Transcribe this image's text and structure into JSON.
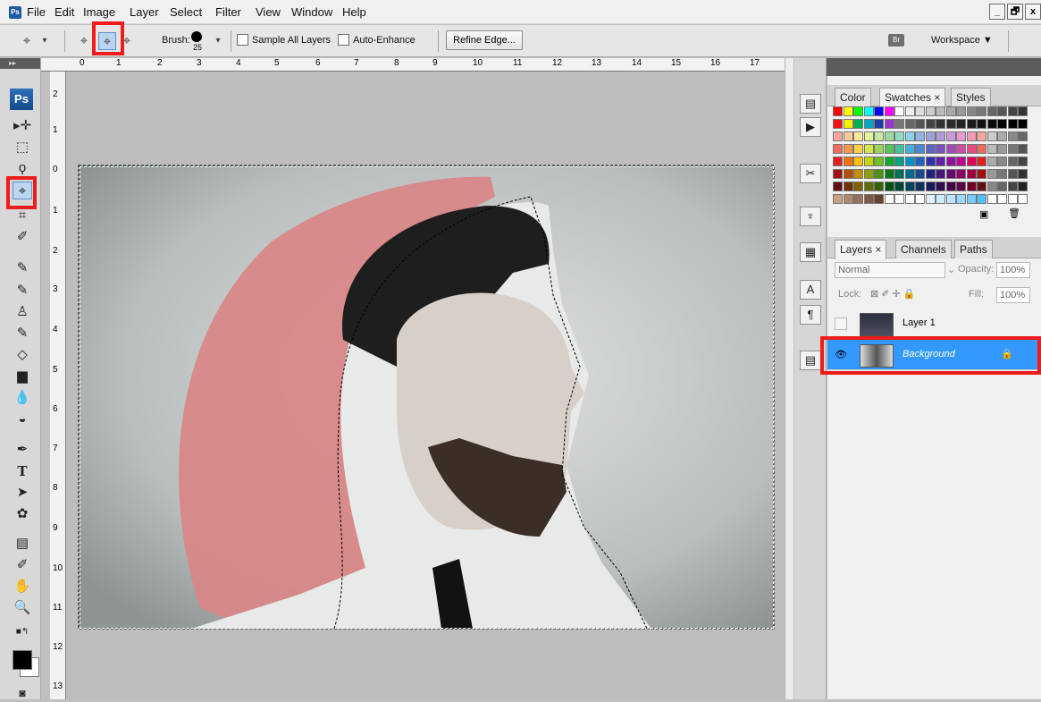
{
  "menu": {
    "app_icon": "Ps",
    "items": [
      "File",
      "Edit",
      "Image",
      "Layer",
      "Select",
      "Filter",
      "View",
      "Window",
      "Help"
    ]
  },
  "window_controls": [
    "_",
    "🗗",
    "x"
  ],
  "options_bar": {
    "brush_label": "Brush:",
    "brush_size": "25",
    "sample_all_layers": "Sample All Layers",
    "auto_enhance": "Auto-Enhance",
    "refine_edge": "Refine Edge...",
    "bridge_icon": "Br",
    "workspace": "Workspace ▼"
  },
  "toolbox": {
    "logo": "Ps"
  },
  "ruler_h": [
    "0",
    "1",
    "2",
    "3",
    "4",
    "5",
    "6",
    "7",
    "8",
    "9",
    "10",
    "11",
    "12",
    "13",
    "14",
    "15",
    "16",
    "17"
  ],
  "ruler_v": [
    "2",
    "1",
    "0",
    "1",
    "2",
    "3",
    "4",
    "5",
    "6",
    "7",
    "8",
    "9",
    "10",
    "11",
    "12",
    "13"
  ],
  "color_panel": {
    "tabs": [
      "Color",
      "Swatches ×",
      "Styles"
    ]
  },
  "layers_panel": {
    "tabs": [
      "Layers ×",
      "Channels",
      "Paths"
    ],
    "blend_mode": "Normal",
    "opacity_label": "Opacity:",
    "opacity_value": "100%",
    "lock_label": "Lock:",
    "fill_label": "Fill:",
    "fill_value": "100%",
    "layers": [
      {
        "name": "Layer 1"
      },
      {
        "name": "Background"
      }
    ]
  },
  "colors": {
    "selection_red": "#ee1c1c",
    "active_layer": "#3399ff",
    "mask_red": "#d98585"
  }
}
